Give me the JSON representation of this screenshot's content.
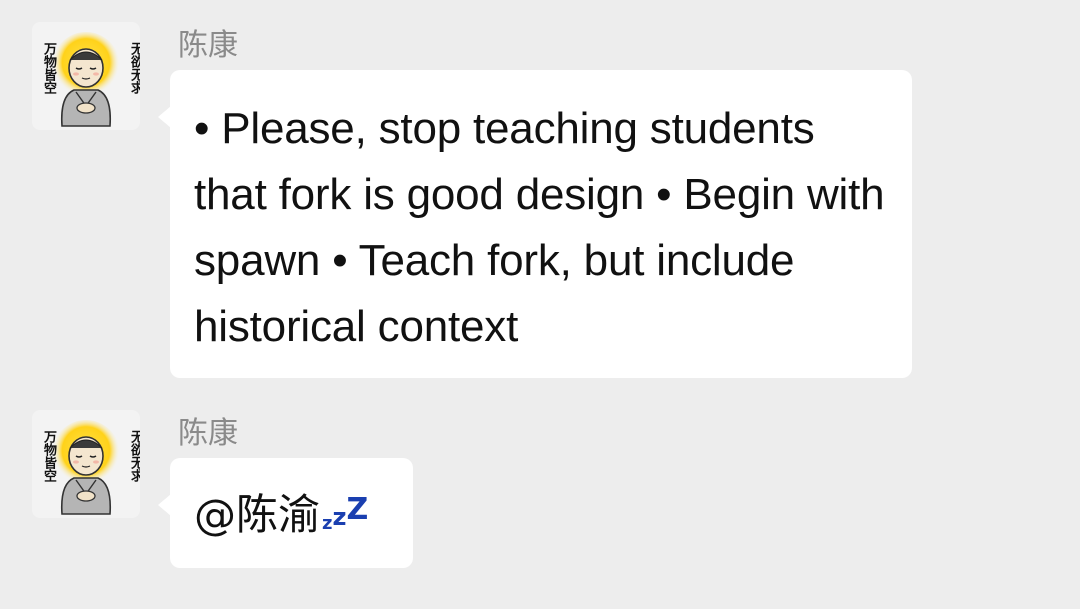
{
  "messages": [
    {
      "sender": "陈康",
      "avatar": {
        "left_text": "万物皆空",
        "right_text": "无欲无求"
      },
      "text": "• Please, stop teaching students that fork is good design • Begin with spawn • Teach fork, but include historical context"
    },
    {
      "sender": "陈康",
      "avatar": {
        "left_text": "万物皆空",
        "right_text": "无欲无求"
      },
      "text": "@陈渝",
      "emoji": "sleeping-zzz-icon",
      "emoji_glyphs": [
        "z",
        "z",
        "Z"
      ]
    }
  ],
  "colors": {
    "background": "#ededed",
    "bubble": "#ffffff",
    "sender_name": "#8a8a8a",
    "zzz": "#1a3fb0"
  }
}
